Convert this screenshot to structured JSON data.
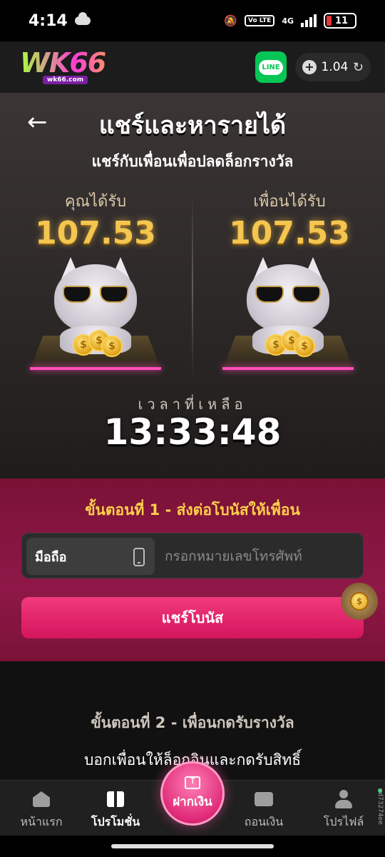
{
  "status_bar": {
    "time": "4:14",
    "network_badge": "Vo LTE",
    "network_type": "4G",
    "battery_level": "11"
  },
  "header": {
    "logo_text": "WK66",
    "logo_sub": "wk66.com",
    "line_label": "LINE",
    "balance": "1.04"
  },
  "hero": {
    "title": "แชร์และหารายได้",
    "subtitle": "แชร์กับเพื่อนเพื่อปลดล็อกรางวัล",
    "you_receive_label": "คุณได้รับ",
    "you_receive_amount": "107.53",
    "friend_receive_label": "เพื่อนได้รับ",
    "friend_receive_amount": "107.53",
    "time_left_label": "เวลาที่เหลือ",
    "countdown": "13:33:48"
  },
  "step1": {
    "title": "ขั้นตอนที่ 1 - ส่งต่อโบนัสให้เพื่อน",
    "phone_tag": "มือถือ",
    "phone_placeholder": "กรอกหมายเลขโทรศัพท์",
    "phone_value": "",
    "share_button": "แชร์โบนัส"
  },
  "step2": {
    "title": "ขั้นตอนที่ 2 - เพื่อนกดรับรางวัล",
    "text": "บอกเพื่อนให้ล็อกอินและกดรับสิทธิ์"
  },
  "bottom_nav": {
    "items": [
      {
        "label": "หน้าแรก",
        "icon": "home-icon"
      },
      {
        "label": "โปรโมชั่น",
        "icon": "gift-icon",
        "active": true
      },
      {
        "label": "ฝากเงิน",
        "icon": "deposit-icon"
      },
      {
        "label": "ถอนเงิน",
        "icon": "wallet-icon"
      },
      {
        "label": "โปรไฟล์",
        "icon": "profile-icon"
      }
    ]
  },
  "version": "vd73274ee",
  "colors": {
    "accent_pink": "#e02a78",
    "gold": "#f4c650",
    "step1_bg": "#8e1848"
  }
}
